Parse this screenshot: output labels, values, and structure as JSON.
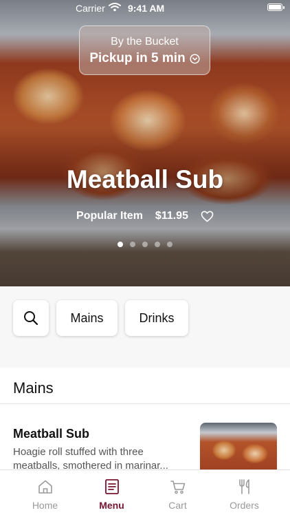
{
  "status_bar": {
    "carrier": "Carrier",
    "time": "9:41 AM"
  },
  "pickup": {
    "title": "By the Bucket",
    "subtitle": "Pickup in 5 min"
  },
  "hero": {
    "title": "Meatball Sub",
    "tag": "Popular Item",
    "price": "$11.95",
    "carousel": {
      "count": 5,
      "active": 0
    }
  },
  "chips": {
    "search_icon": "search-icon",
    "items": [
      "Mains",
      "Drinks"
    ]
  },
  "section": {
    "title": "Mains"
  },
  "menu_items": [
    {
      "name": "Meatball Sub",
      "description": "Hoagie roll stuffed with three meatballs, smothered in marinar..."
    }
  ],
  "tabbar": {
    "items": [
      {
        "label": "Home",
        "icon": "home-icon"
      },
      {
        "label": "Menu",
        "icon": "menu-icon"
      },
      {
        "label": "Cart",
        "icon": "cart-icon"
      },
      {
        "label": "Orders",
        "icon": "orders-icon"
      }
    ],
    "active": "Menu"
  },
  "colors": {
    "accent": "#7a1430",
    "inactive": "#9a9a9a"
  }
}
